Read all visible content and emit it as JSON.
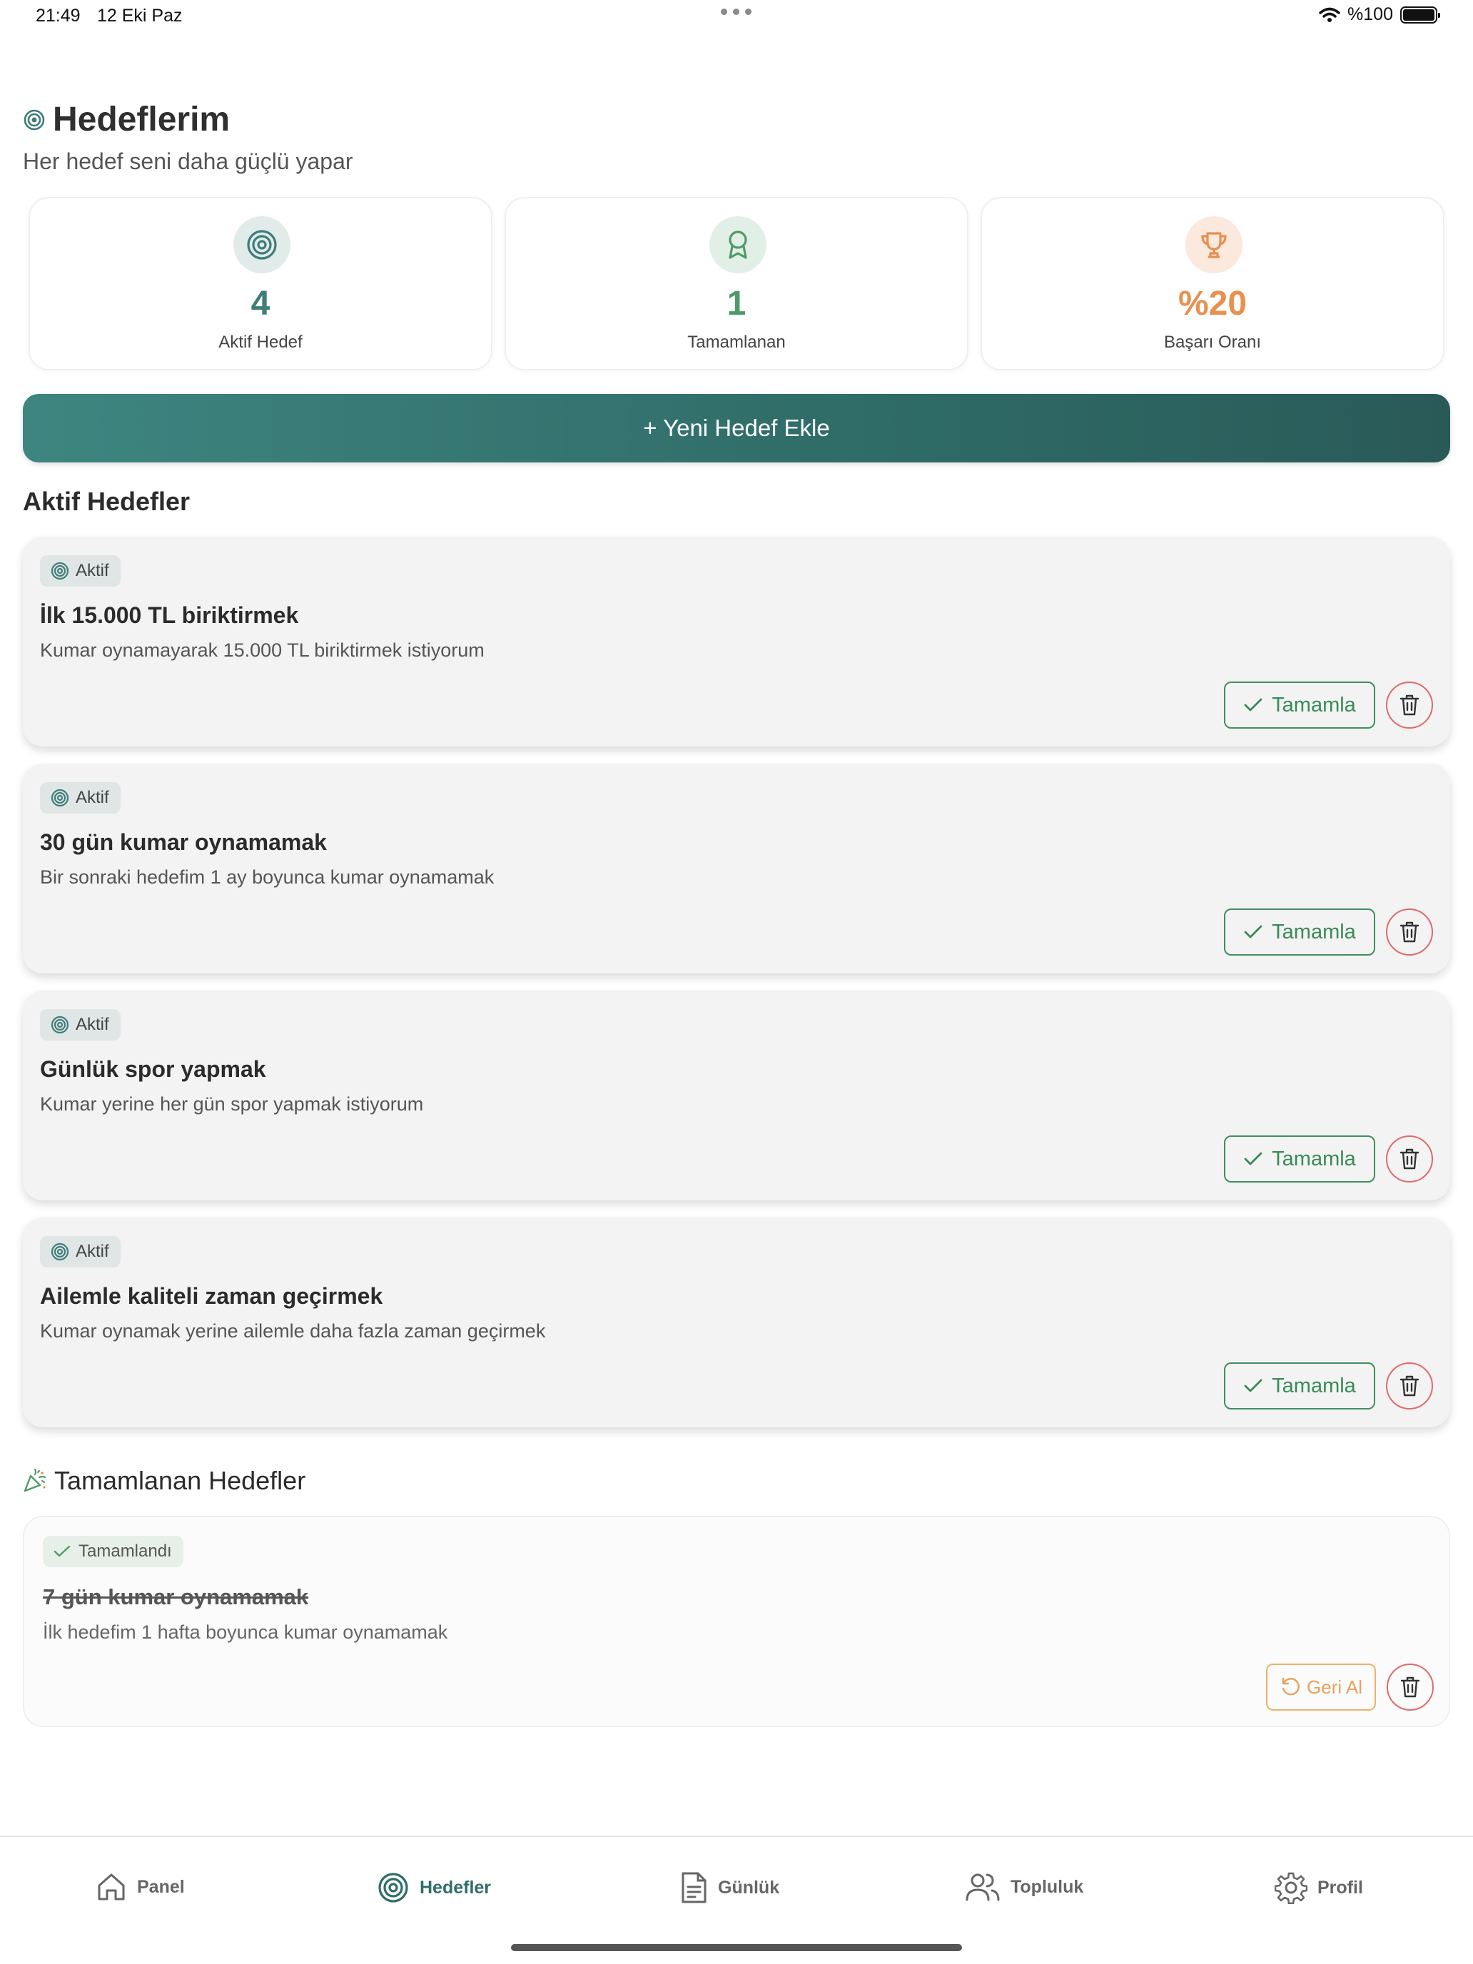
{
  "status_bar": {
    "time": "21:49",
    "date": "12 Eki Paz",
    "battery": "%100"
  },
  "header": {
    "title": "Hedeflerim",
    "subtitle": "Her hedef seni daha güçlü yapar"
  },
  "stats": [
    {
      "icon": "target-icon",
      "value": "4",
      "label": "Aktif Hedef",
      "color": "#3f7d79"
    },
    {
      "icon": "award-icon",
      "value": "1",
      "label": "Tamamlanan",
      "color": "#4f9a6a"
    },
    {
      "icon": "trophy-icon",
      "value": "%20",
      "label": "Başarı Oranı",
      "color": "#e8904f"
    }
  ],
  "add_button": {
    "label": "+ Yeni Hedef Ekle"
  },
  "active_section": {
    "title": "Aktif Hedefler"
  },
  "active_goals": [
    {
      "badge": "Aktif",
      "title": "İlk 15.000 TL biriktirmek",
      "description": "Kumar oynamayarak 15.000 TL biriktirmek istiyorum",
      "complete_label": "Tamamla"
    },
    {
      "badge": "Aktif",
      "title": "30 gün kumar oynamamak",
      "description": "Bir sonraki hedefim 1 ay boyunca kumar oynamamak",
      "complete_label": "Tamamla"
    },
    {
      "badge": "Aktif",
      "title": "Günlük spor yapmak",
      "description": "Kumar yerine her gün spor yapmak istiyorum",
      "complete_label": "Tamamla"
    },
    {
      "badge": "Aktif",
      "title": "Ailemle kaliteli zaman geçirmek",
      "description": "Kumar oynamak yerine ailemle daha fazla zaman geçirmek",
      "complete_label": "Tamamla"
    }
  ],
  "completed_section": {
    "title": "Tamamlanan Hedefler",
    "icon": "party-popper-icon"
  },
  "completed_goals": [
    {
      "badge": "Tamamlandı",
      "title": "7 gün kumar oynamamak",
      "description": "İlk hedefim 1 hafta boyunca kumar oynamamak",
      "undo_label": "Geri Al"
    }
  ],
  "tab_bar": {
    "active": "Hedefler",
    "items": [
      {
        "label": "Panel",
        "icon": "home-icon"
      },
      {
        "label": "Hedefler",
        "icon": "target-icon"
      },
      {
        "label": "Günlük",
        "icon": "document-icon"
      },
      {
        "label": "Topluluk",
        "icon": "users-icon"
      },
      {
        "label": "Profil",
        "icon": "gear-icon"
      }
    ]
  },
  "colors": {
    "primary": "#2f6b67",
    "success": "#3a8a58",
    "danger": "#e06a6a",
    "warning": "#e8a15c"
  }
}
